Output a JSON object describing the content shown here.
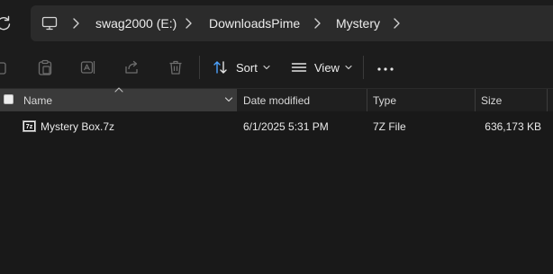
{
  "address_bar": {
    "breadcrumbs": [
      "swag2000 (E:)",
      "DownloadsPime",
      "Mystery"
    ],
    "icons": {
      "refresh": "refresh-icon",
      "root": "this-pc-icon",
      "separator": "chevron-right-icon"
    }
  },
  "command_bar": {
    "icons": [
      "copy-icon",
      "paste-icon",
      "rename-icon",
      "share-icon",
      "delete-icon"
    ],
    "sort_label": "Sort",
    "view_label": "View",
    "more_icon": "more-icon"
  },
  "columns": {
    "name": "Name",
    "date_modified": "Date modified",
    "type": "Type",
    "size": "Size",
    "sorted_by": "Name"
  },
  "files": [
    {
      "name": "Mystery Box.7z",
      "date_modified": "6/1/2025 5:31 PM",
      "type": "7Z File",
      "size": "636,173 KB",
      "icon": "7z-archive-icon",
      "icon_text": "7z"
    }
  ],
  "colors": {
    "background": "#191919",
    "address_box": "#2b2b2b",
    "header_selected": "#3a3a3a",
    "text": "#e8e8e8"
  }
}
